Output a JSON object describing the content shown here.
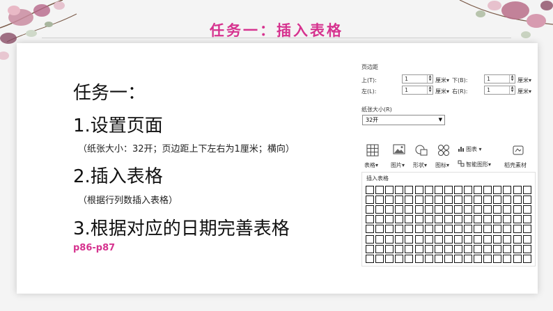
{
  "slide": {
    "title": "任务一：插入表格",
    "heading": "任务一：",
    "item1": "1.设置页面",
    "note1": "（纸张大小：32开；页边距上下左右为1厘米；横向）",
    "item2": "2.插入表格",
    "note2": "（根据行列数插入表格）",
    "item3": "3.根据对应的日期完善表格",
    "pages": "p86-p87"
  },
  "margin_dialog": {
    "title": "页边距",
    "top_label": "上(T):",
    "bottom_label": "下(B):",
    "left_label": "左(L):",
    "right_label": "右(R):",
    "top_value": "1",
    "bottom_value": "1",
    "left_value": "1",
    "right_value": "1",
    "unit": "厘米",
    "paper_label": "纸张大小(R)",
    "paper_value": "32开"
  },
  "ribbon": {
    "table": "表格",
    "picture": "图片",
    "shape": "形状",
    "icon": "图标",
    "chart": "图表",
    "smart_art": "智能图形",
    "material": "稻壳素材"
  },
  "grid": {
    "label": "插入表格",
    "cols": 17,
    "rows": 8
  },
  "colors": {
    "accent": "#d6338f"
  }
}
